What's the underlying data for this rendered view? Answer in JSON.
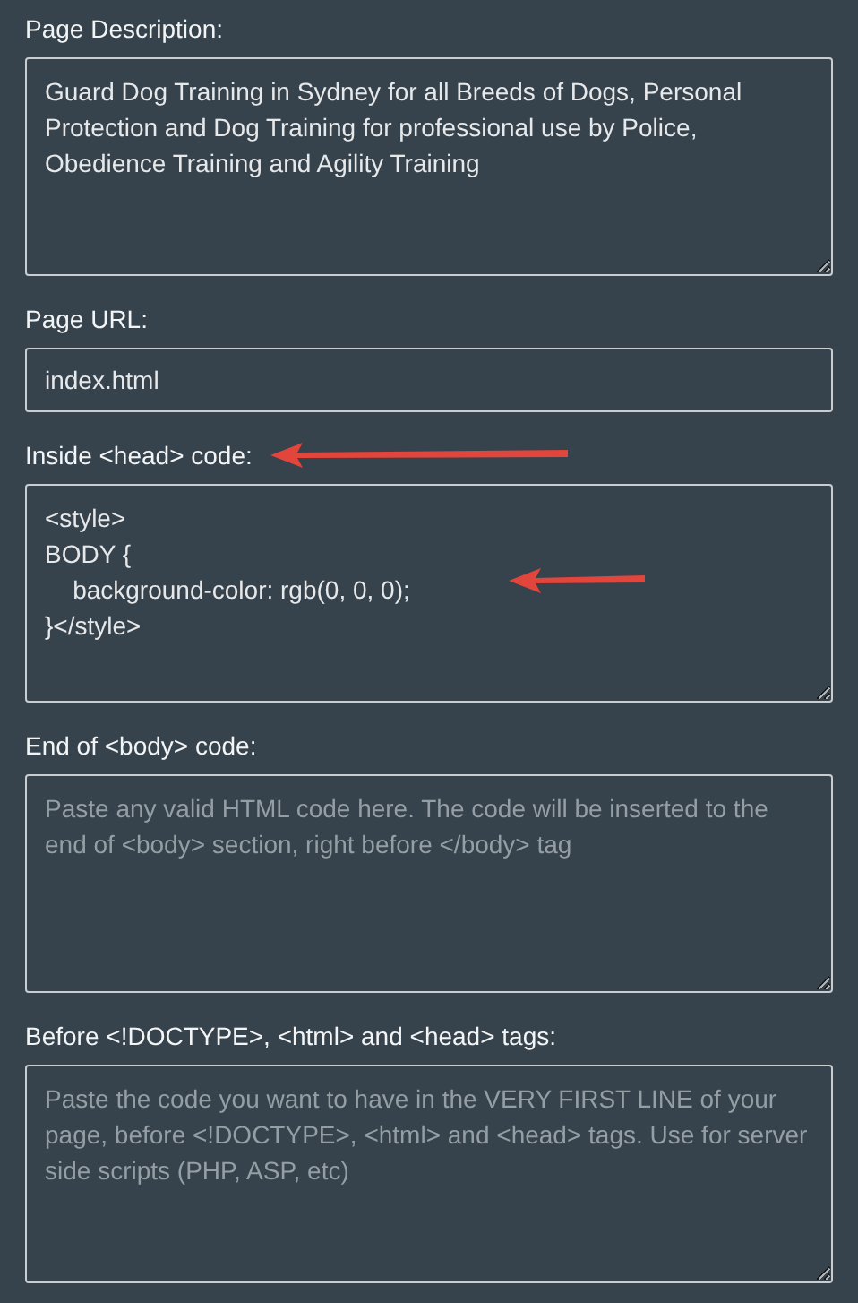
{
  "fields": [
    {
      "kind": "textarea",
      "label": "Page Description:",
      "value": "Guard Dog Training in Sydney for all Breeds of Dogs, Personal Protection and Dog Training for professional use by Police, Obedience Training and Agility Training"
    },
    {
      "kind": "input",
      "label": "Page URL:",
      "value": "index.html"
    },
    {
      "kind": "textarea",
      "label": "Inside <head> code:",
      "value": "<style>\nBODY {\n\tbackground-color: rgb(0, 0, 0);\n}</style>"
    },
    {
      "kind": "textarea",
      "label": "End of <body> code:",
      "placeholder": "Paste any valid HTML code here. The code will be inserted to the end of <body> section, right before </body> tag"
    },
    {
      "kind": "textarea",
      "label": "Before <!DOCTYPE>, <html> and <head> tags:",
      "placeholder": "Paste the code you want to have in the VERY FIRST LINE of your page, before <!DOCTYPE>, <html> and <head> tags. Use for server side scripts (PHP, ASP, etc)"
    }
  ]
}
